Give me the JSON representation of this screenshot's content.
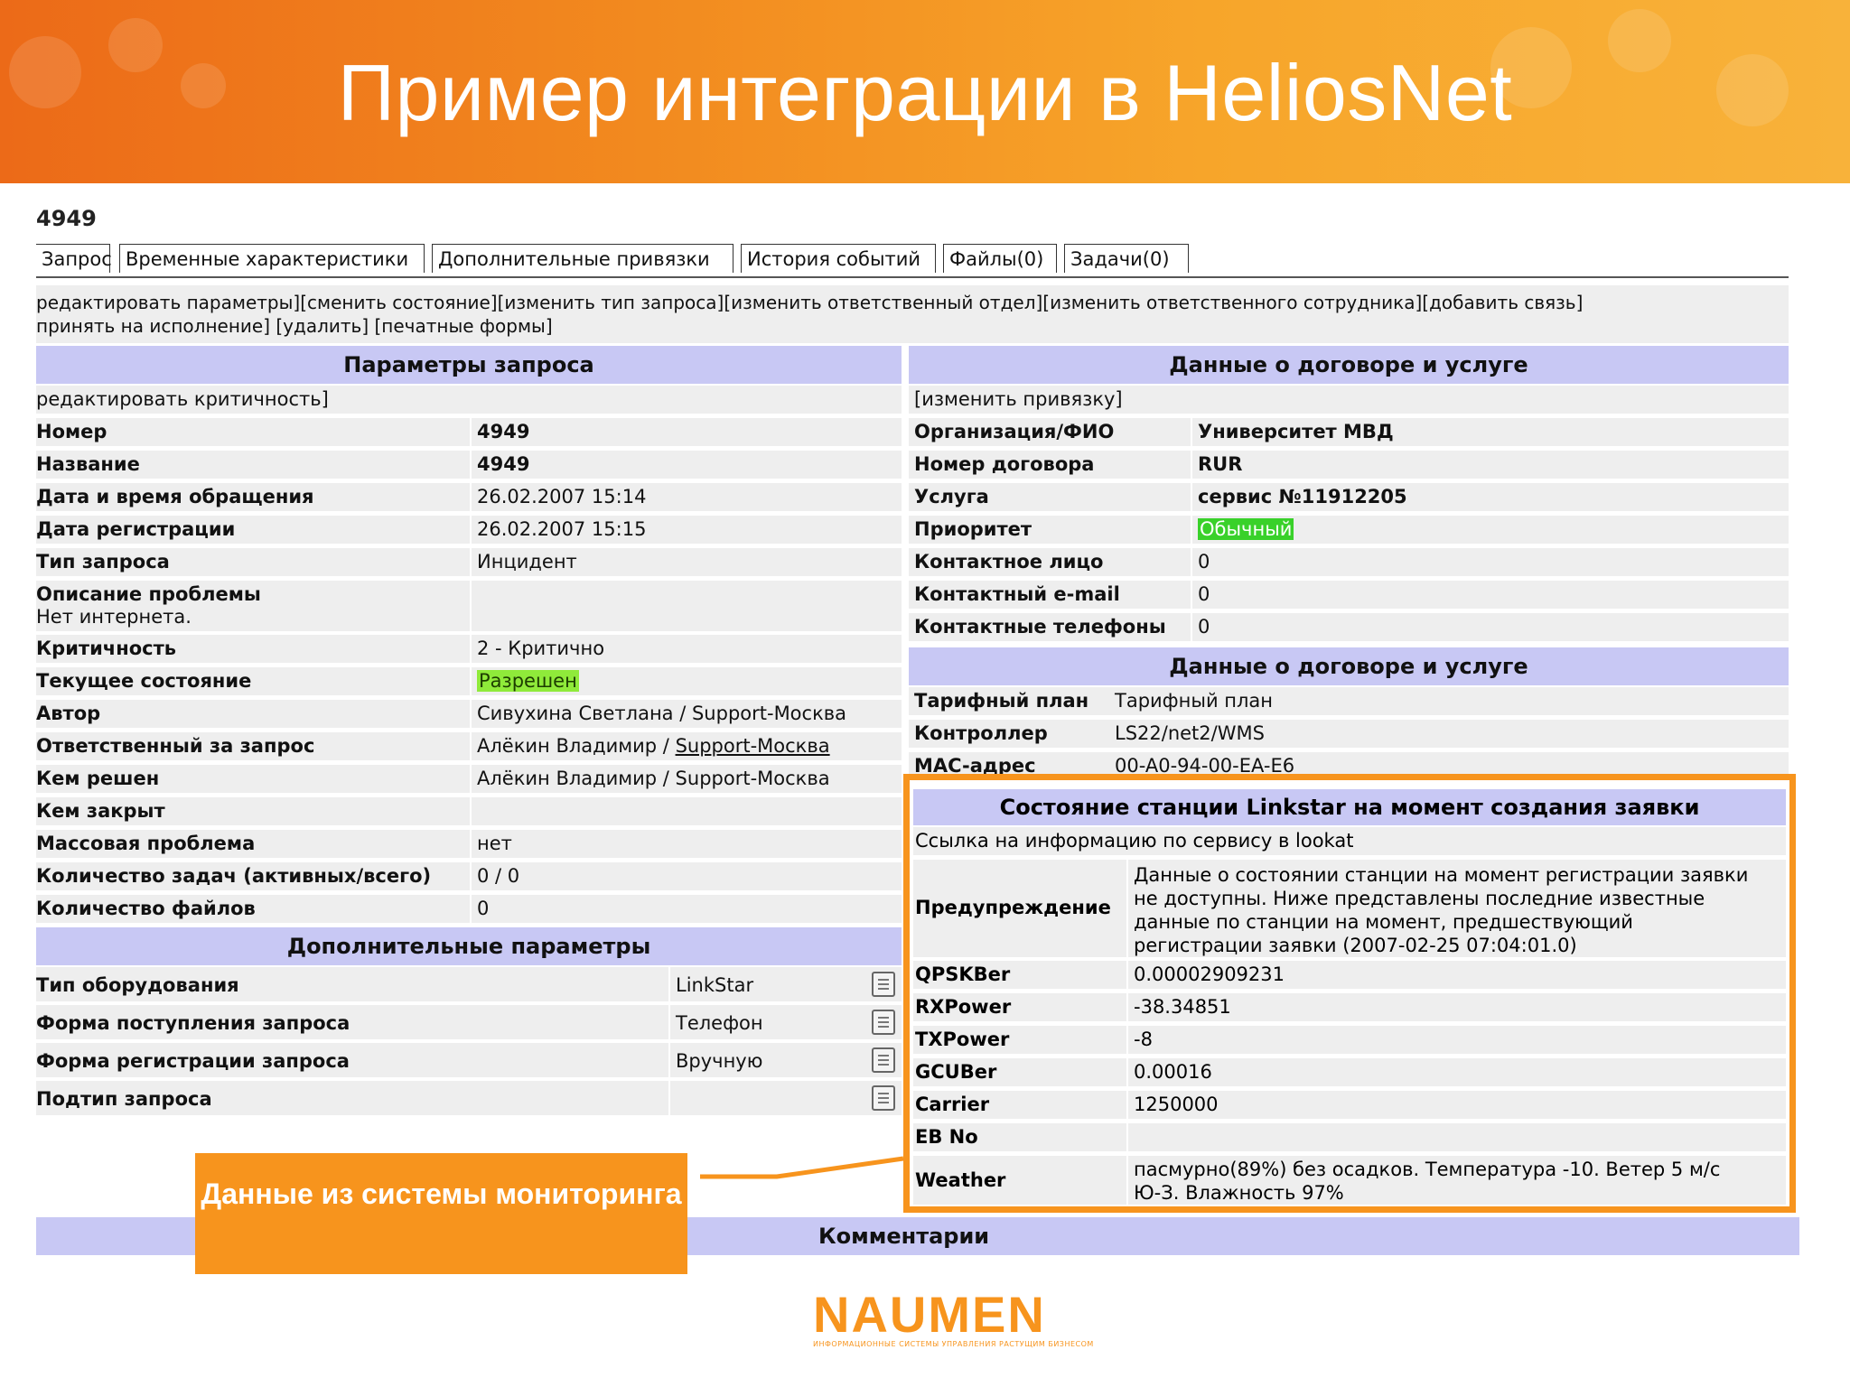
{
  "slide": {
    "title": "Пример интеграции в HeliosNet",
    "callout": "Данные из системы мониторинга",
    "logo_text": "NAUMEN",
    "logo_sub": "ИНФОРМАЦИОННЫЕ СИСТЕМЫ УПРАВЛЕНИЯ РАСТУЩИМ БИЗНЕСОМ",
    "accent_color": "#f7941d"
  },
  "request_id": "4949",
  "tabs": [
    "Запрос",
    "Временные характеристики",
    "Дополнительные привязки",
    "История событий",
    "Файлы(0)",
    "Задачи(0)"
  ],
  "actions": {
    "line1": "редактировать параметры][сменить состояние][изменить тип запроса][изменить ответственный отдел][изменить ответственного сотрудника][добавить связь]",
    "line2": "принять на исполнение] [удалить] [печатные формы]"
  },
  "params": {
    "header": "Параметры запроса",
    "edit_link": "редактировать критичность]",
    "rows": [
      {
        "k": "Номер",
        "v": "4949"
      },
      {
        "k": "Название",
        "v": "4949"
      },
      {
        "k": "Дата и время обращения",
        "v": "26.02.2007 15:14"
      },
      {
        "k": "Дата регистрации",
        "v": "26.02.2007 15:15"
      },
      {
        "k": "Тип запроса",
        "v": "Инцидент"
      },
      {
        "k": "Описание проблемы",
        "v": "Нет интернета."
      },
      {
        "k": "Критичность",
        "v": "2 - Критично"
      },
      {
        "k": "Текущее состояние",
        "v": "Разрешен"
      },
      {
        "k": "Автор",
        "v": "Сивухина Светлана / Support-Москва"
      },
      {
        "k": "Ответственный за запрос",
        "v": "Алёкин Владимир / ",
        "v_link": "Support-Москва"
      },
      {
        "k": "Кем решен",
        "v": "Алёкин Владимир / Support-Москва"
      },
      {
        "k": "Кем закрыт",
        "v": ""
      },
      {
        "k": "Массовая проблема",
        "v": "нет"
      },
      {
        "k": "Количество задач (активных/всего)",
        "v": "0 / 0"
      },
      {
        "k": "Количество файлов",
        "v": "0"
      }
    ]
  },
  "extra": {
    "header": "Дополнительные параметры",
    "rows": [
      {
        "k": "Тип оборудования",
        "v": "LinkStar"
      },
      {
        "k": "Форма поступления запроса",
        "v": "Телефон"
      },
      {
        "k": "Форма регистрации запроса",
        "v": "Вручную"
      },
      {
        "k": "Подтип запроса",
        "v": ""
      }
    ]
  },
  "contract": {
    "header": "Данные о договоре и услуге",
    "edit_link": "[изменить привязку]",
    "rows": [
      {
        "k": "Организация/ФИО",
        "v": "Университет МВД"
      },
      {
        "k": "Номер договора",
        "v": "RUR"
      },
      {
        "k": "Услуга",
        "v": "сервис №11912205"
      },
      {
        "k": "Приоритет",
        "v": "Обычный"
      },
      {
        "k": "Контактное лицо",
        "v": "0"
      },
      {
        "k": "Контактный e-mail",
        "v": "0"
      },
      {
        "k": "Контактные телефоны",
        "v": "0"
      }
    ]
  },
  "contract2": {
    "header": "Данные о договоре и услуге",
    "rows": [
      {
        "k": "Тарифный план",
        "v": "Тарифный план"
      },
      {
        "k": "Контроллер",
        "v": "LS22/net2/WMS"
      },
      {
        "k": "MAC-адрес",
        "v": "00-A0-94-00-EA-E6"
      }
    ]
  },
  "linkstar": {
    "header": "Состояние станции Linkstar на момент создания заявки",
    "link": "Ссылка на информацию по сервису в lookat",
    "warning_label": "Предупреждение",
    "warning_lines": [
      "Данные о состоянии станции на момент регистрации заявки",
      "не доступны. Ниже представлены последние известные",
      "данные по станции на момент, предшествующий",
      "регистрации заявки (2007-02-25 07:04:01.0)"
    ],
    "rows": [
      {
        "k": "QPSKBer",
        "v": "0.00002909231"
      },
      {
        "k": "RXPower",
        "v": "-38.34851"
      },
      {
        "k": "TXPower",
        "v": "-8"
      },
      {
        "k": "GCUBer",
        "v": "0.00016"
      },
      {
        "k": "Carrier",
        "v": "1250000"
      },
      {
        "k": "EB No",
        "v": ""
      }
    ],
    "weather_label": "Weather",
    "weather_lines": [
      "пасмурно(89%) без осадков. Температура -10. Ветер 5 м/с",
      "Ю-З. Влажность 97%"
    ]
  },
  "comments_header": "Комментарии"
}
